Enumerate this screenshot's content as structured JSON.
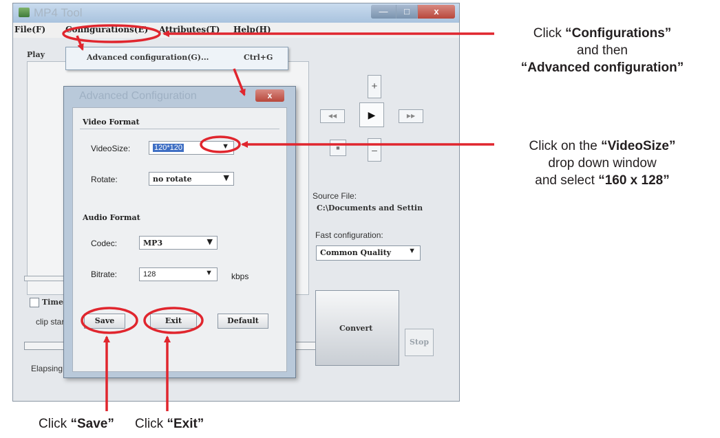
{
  "window": {
    "title": "MP4 Tool",
    "controls": {
      "minimize": "—",
      "maximize": "□",
      "close": "x"
    }
  },
  "menu": [
    "File(F)",
    "Configurations(E)",
    "Attributes(T)",
    "Help(H)"
  ],
  "dropdown": {
    "item": "Advanced configuration(G)...",
    "shortcut": "Ctrl+G"
  },
  "main": {
    "play_label": "Play",
    "timeline_label": "Time",
    "clip_label": "clip star",
    "elapsed_label": "Elapsing",
    "zoom_in": "+",
    "zoom_out": "–",
    "rewind": "◀◀",
    "play": "▶",
    "forward": "▶▶",
    "stop_square": "■",
    "source_label": "Source File:",
    "source_path": "C:\\Documents and Settin",
    "fast_label": "Fast configuration:",
    "fast_value": "Common Quality",
    "convert": "Convert",
    "stop": "Stop"
  },
  "dialog": {
    "title": "Advanced Configuration",
    "close": "x",
    "video_group": "Video Format",
    "videosize_label": "VideoSize:",
    "videosize_value": "120*120",
    "rotate_label": "Rotate:",
    "rotate_value": "no rotate",
    "audio_group": "Audio Format",
    "codec_label": "Codec:",
    "codec_value": "MP3",
    "bitrate_label": "Bitrate:",
    "bitrate_value": "128",
    "kbps": "kbps",
    "save": "Save",
    "exit": "Exit",
    "default": "Default"
  },
  "annotations": {
    "a1_l1_pre": "Click ",
    "a1_l1_bold": "“Configurations”",
    "a1_l2": "and then",
    "a1_l3_bold": "“Advanced configuration”",
    "a2_l1_pre": "Click on the ",
    "a2_l1_bold": "“VideoSize”",
    "a2_l2": "drop down window",
    "a2_l3_pre": "and select ",
    "a2_l3_bold": "“160 x 128”",
    "a3_pre": "Click ",
    "a3_bold": "“Save”",
    "a4_pre": "Click ",
    "a4_bold": "“Exit”",
    "annotation_color": "#e0262e"
  }
}
